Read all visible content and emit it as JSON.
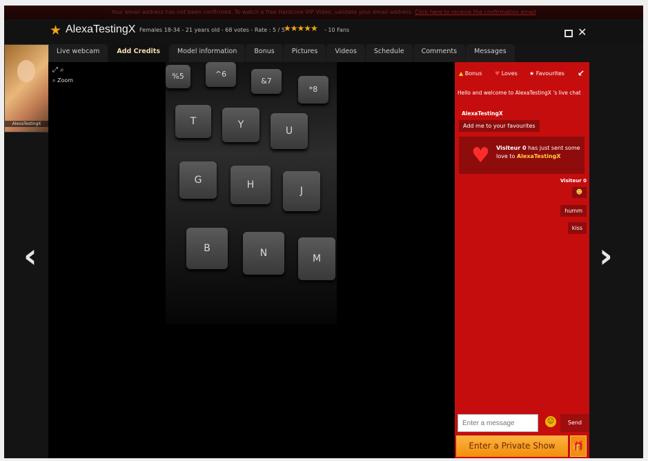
{
  "notice": {
    "text": "Your email address has not been confirmed. To watch a free Hardcore VIP Video, validate your email address.",
    "link": "Click here to receive the confirmation email"
  },
  "header": {
    "model_name": "AlexaTestingX",
    "meta": "Females 18-34 - 21 years old - 68 votes - Rate : 5 / 5",
    "rating_stars": "★★★★★",
    "fans": "- 10 Fans"
  },
  "tabs": [
    {
      "label": "Live webcam"
    },
    {
      "label": "Add Credits"
    },
    {
      "label": "Model information"
    },
    {
      "label": "Bonus"
    },
    {
      "label": "Pictures"
    },
    {
      "label": "Videos"
    },
    {
      "label": "Schedule"
    },
    {
      "label": "Comments"
    },
    {
      "label": "Messages"
    }
  ],
  "sidebar": {
    "thumb_label": "AlexaTestingX"
  },
  "player": {
    "zoom_label": "Zoom"
  },
  "video_keys": [
    "%5",
    "^6",
    "&7",
    "*8",
    "T",
    "Y",
    "U",
    "G",
    "H",
    "J",
    "B",
    "N",
    "M"
  ],
  "chat": {
    "bonus_label": "Bonus",
    "loves_label": "Loves",
    "favourites_label": "Favourites",
    "welcome": "Hello and welcome to AlexaTestingX 's live chat",
    "sender": "AlexaTestingX",
    "sender_message": "Add me to your favourites",
    "love_user": "Visiteur 0",
    "love_text_mid": "has just sent some love to",
    "love_model": "AlexaTestingX",
    "visitor_name": "Visiteur 0",
    "msg_humm": "humm",
    "msg_kiss": "kiss",
    "input_placeholder": "Enter a message",
    "send_label": "Send",
    "private_show_label": "Enter a Private Show"
  }
}
